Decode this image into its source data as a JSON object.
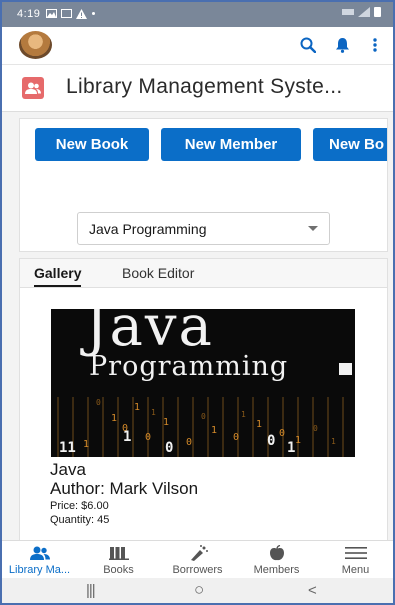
{
  "status_bar": {
    "time": "4:19",
    "left_icons": [
      "image-icon",
      "cast-icon",
      "warning-icon",
      "dot-icon"
    ],
    "right_icons": [
      "lte-icon",
      "signal-icon",
      "battery-icon"
    ]
  },
  "app_bar": {
    "icons": [
      "avatar",
      "search-icon",
      "bell-icon",
      "more-vertical-icon"
    ]
  },
  "page": {
    "title": "Library Management Syste..."
  },
  "actions": {
    "new_book": "New Book",
    "new_member": "New Member",
    "new_borrower_partial": "New Bo"
  },
  "book_select": {
    "value": "Java Programming"
  },
  "tabs": [
    {
      "label": "Gallery",
      "active": true
    },
    {
      "label": "Book Editor",
      "active": false
    }
  ],
  "book": {
    "cover_title": "Java",
    "cover_subtitle": "Programming",
    "title": "Java",
    "author": "Author: Mark Vilson",
    "price": "Price: $6.00",
    "quantity": "Quantity: 45"
  },
  "bottom_nav": [
    {
      "label": "Library Ma...",
      "icon": "people-icon",
      "active": true
    },
    {
      "label": "Books",
      "icon": "book-icon",
      "active": false
    },
    {
      "label": "Borrowers",
      "icon": "wand-icon",
      "active": false
    },
    {
      "label": "Members",
      "icon": "apple-icon",
      "active": false
    },
    {
      "label": "Menu",
      "icon": "hamburger-icon",
      "active": false
    }
  ],
  "system_nav": {
    "recents": "|||",
    "home": "○",
    "back": "<"
  },
  "colors": {
    "brand_blue": "#0b6ec8",
    "app_icon": "#e66a6b",
    "status_bar": "#7a8799"
  }
}
